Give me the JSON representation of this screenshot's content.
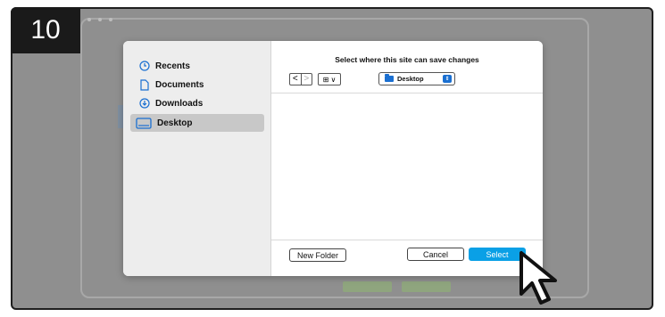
{
  "step": {
    "number": "10"
  },
  "dialog": {
    "title": "Select where this site can save changes",
    "sidebar": {
      "items": [
        {
          "label": "Recents",
          "icon": "clock-icon"
        },
        {
          "label": "Documents",
          "icon": "document-icon"
        },
        {
          "label": "Downloads",
          "icon": "download-icon"
        },
        {
          "label": "Desktop",
          "icon": "desktop-icon",
          "active": true
        }
      ]
    },
    "toolbar": {
      "back": "<",
      "forward": ">",
      "view_label": "⊞ ∨",
      "location": "Desktop"
    },
    "buttons": {
      "new_folder": "New Folder",
      "cancel": "Cancel",
      "select": "Select"
    }
  },
  "colors": {
    "accent": "#0aa0e6",
    "folder": "#1a6fd1",
    "backdrop": "#8f8f8f",
    "badge": "#1a1a1a"
  }
}
